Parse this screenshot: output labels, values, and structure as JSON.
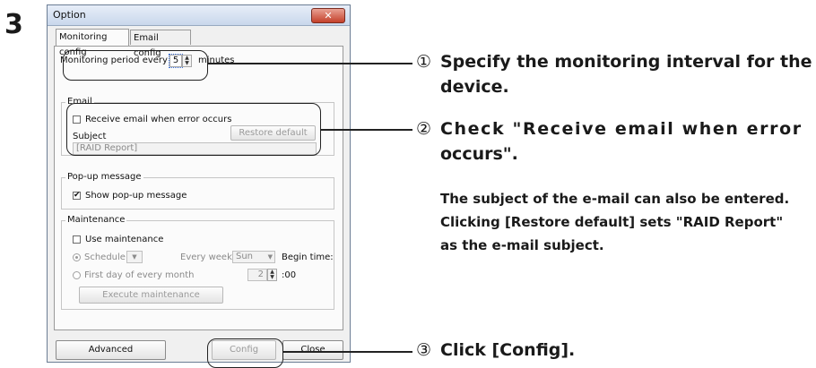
{
  "step_number": "3",
  "dialog": {
    "title": "Option",
    "close_icon": "close-icon",
    "tabs": [
      {
        "label": "Monitoring config",
        "selected": true
      },
      {
        "label": "Email config",
        "selected": false
      }
    ],
    "monitoring": {
      "prefix": "Monitoring period every",
      "value": "5",
      "suffix": "minutes"
    },
    "email": {
      "legend": "Email",
      "checkbox_label": "Receive email when error occurs",
      "checked": false,
      "subject_label": "Subject",
      "restore_label": "Restore default",
      "subject_value": "[RAID Report]"
    },
    "popup": {
      "legend": "Pop-up message",
      "checkbox_label": "Show pop-up message",
      "checked": true,
      "check_mark": "✔"
    },
    "maintenance": {
      "legend": "Maintenance",
      "checkbox_label": "Use maintenance",
      "schedule_label": "Schedule",
      "every_week_label": "Every week",
      "day_value": "Sun",
      "begin_time_label": "Begin time:",
      "first_day_label": "First day of every month",
      "hour_value": "2",
      "minutes_value": ":00",
      "execute_label": "Execute maintenance"
    },
    "buttons": {
      "advanced": "Advanced",
      "config": "Config",
      "close": "Close"
    }
  },
  "annotations": {
    "a1_num": "①",
    "a1_line1": "Specify the monitoring interval for the",
    "a1_line2": "device.",
    "a2_num": "②",
    "a2_line1": "Check \"Receive email when error",
    "a2_line2": "occurs\".",
    "note_line1": "The subject of the e-mail can also be entered.",
    "note_line2": "Clicking [Restore default] sets \"RAID  Report\"",
    "note_line3": "as the e-mail subject.",
    "a3_num": "③",
    "a3_text": "Click [Config]."
  }
}
